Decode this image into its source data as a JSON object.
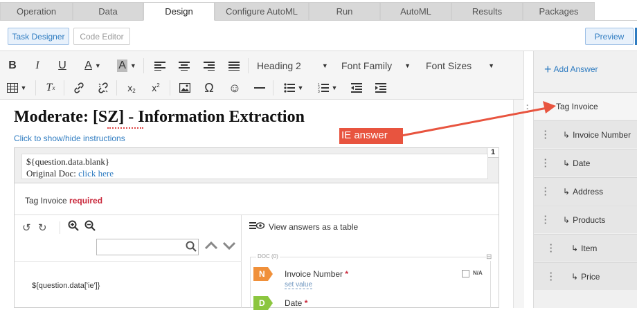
{
  "tabs": [
    "Operation",
    "Data",
    "Design",
    "Configure AutoML",
    "Run",
    "AutoML",
    "Results",
    "Packages"
  ],
  "active_tab": "Design",
  "subtoolbar": {
    "task_designer": "Task Designer",
    "code_editor": "Code Editor",
    "preview": "Preview"
  },
  "editor_toolbar": {
    "heading": "Heading 2",
    "font_family": "Font Family",
    "font_sizes": "Font Sizes",
    "icons_row1": [
      "bold-icon",
      "italic-icon",
      "underline-icon",
      "text-color-icon",
      "highlight-icon",
      "align-left-icon",
      "align-center-icon",
      "align-right-icon",
      "align-justify-icon"
    ],
    "icons_row2": [
      "table-icon",
      "clear-format-icon",
      "link-icon",
      "unlink-icon",
      "subscript-icon",
      "superscript-icon",
      "image-icon",
      "omega-icon",
      "smiley-icon",
      "hr-icon",
      "bullet-list-icon",
      "numbered-list-icon",
      "outdent-icon",
      "indent-icon"
    ]
  },
  "content": {
    "title": "Moderate: [SZ] - Information Extraction",
    "instructions_link": "Click to show/hide instructions",
    "task_number": "1",
    "text_line1": "${question.data.blank}",
    "text_line2_prefix": "Original Doc: ",
    "text_line2_link": "click here",
    "tag_label": "Tag Invoice",
    "tag_required": "required",
    "ie_placeholder": "${question.data['ie']}",
    "view_table": "View answers as a table",
    "doc_label": "DOC (0)",
    "fields": [
      {
        "key": "N",
        "label": "Invoice Number",
        "set_value": "set value",
        "na": "N/A",
        "color": "#f0903a"
      },
      {
        "key": "D",
        "label": "Date",
        "color": "#8cc63f"
      }
    ],
    "required_mark": "*"
  },
  "annotation": {
    "label": "IE answer",
    "color": "#e8543f"
  },
  "sidebar": {
    "add_answer": "Add Answer",
    "items": [
      {
        "label": "Tag Invoice",
        "level": 0
      },
      {
        "label": "Invoice Number",
        "level": 1
      },
      {
        "label": "Date",
        "level": 1
      },
      {
        "label": "Address",
        "level": 1
      },
      {
        "label": "Products",
        "level": 1
      },
      {
        "label": "Item",
        "level": 2
      },
      {
        "label": "Price",
        "level": 2
      }
    ],
    "child_marker": "↳"
  }
}
